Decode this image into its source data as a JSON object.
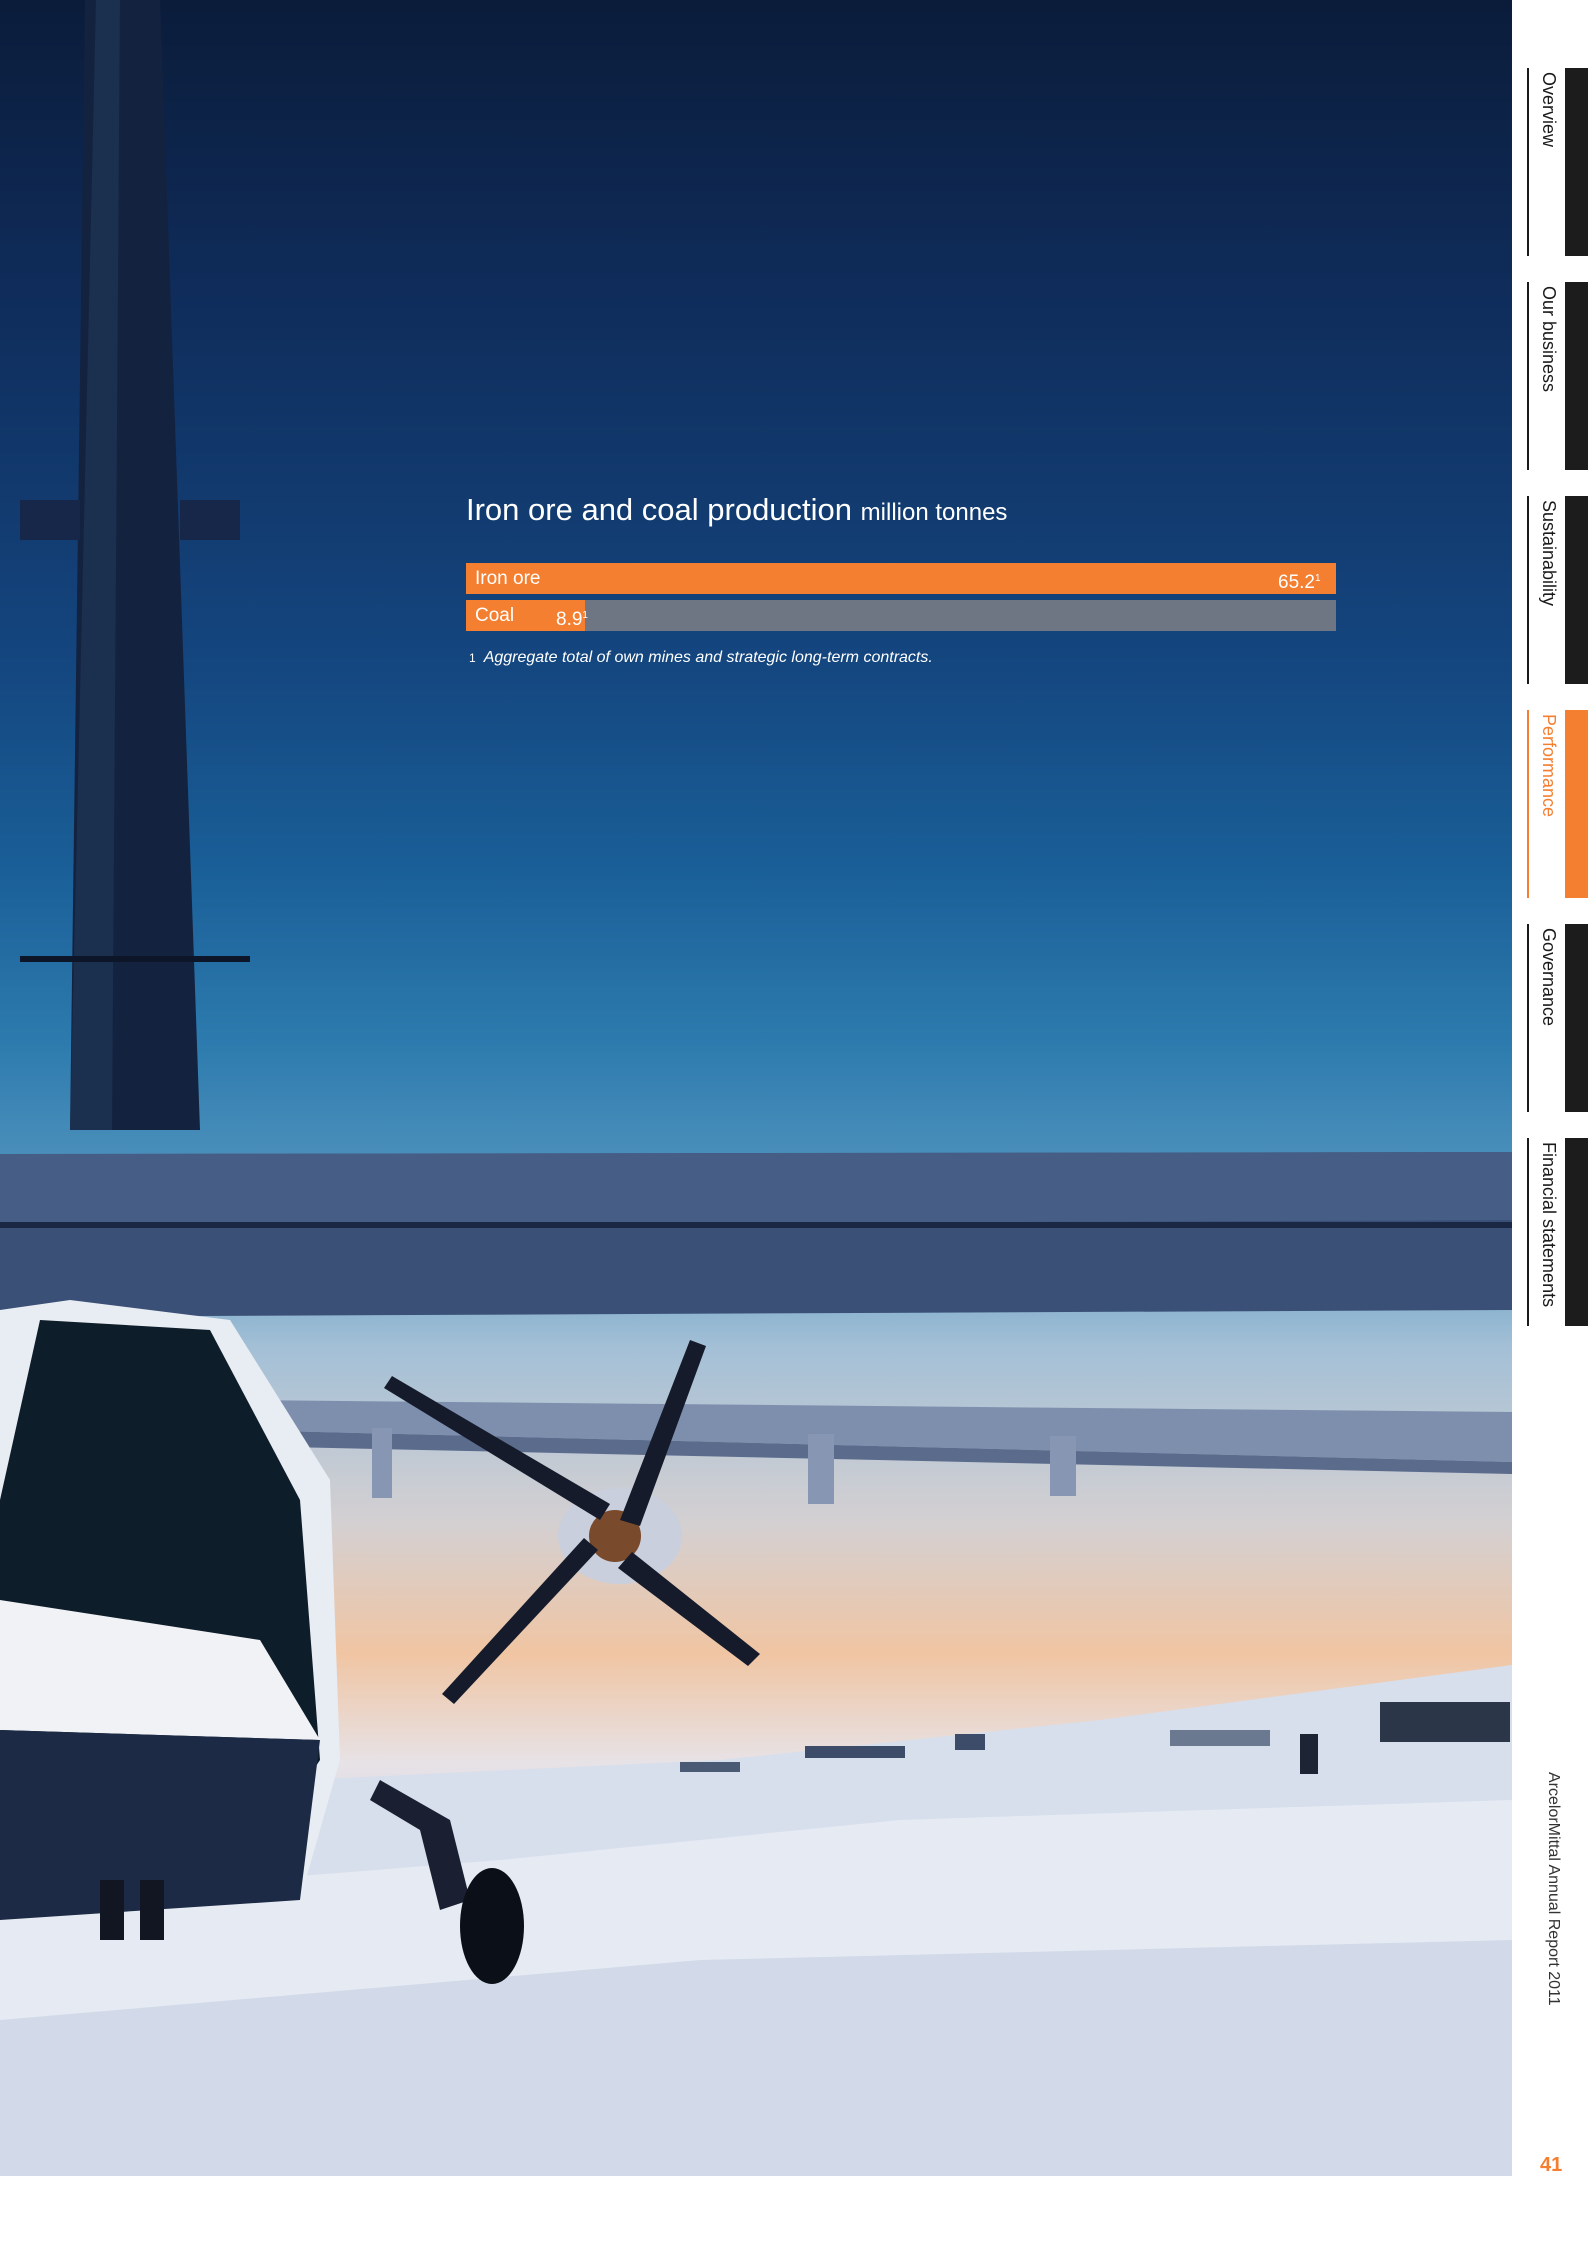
{
  "nav": {
    "items": [
      {
        "label": "Overview"
      },
      {
        "label": "Our business"
      },
      {
        "label": "Sustainability"
      },
      {
        "label": "Performance",
        "active": true
      },
      {
        "label": "Governance"
      },
      {
        "label": "Financial statements"
      }
    ],
    "active_color": "#f47f31"
  },
  "chart": {
    "title": "Iron ore and coal production",
    "unit": "million tonnes",
    "footnote_mark": "1",
    "footnote": "Aggregate total of own mines and strategic long-term contracts."
  },
  "chart_data": {
    "type": "bar",
    "orientation": "horizontal",
    "title": "Iron ore and coal production",
    "unit": "million tonnes",
    "categories": [
      "Iron ore",
      "Coal"
    ],
    "values": [
      65.2,
      8.9
    ],
    "value_labels": [
      "65.2",
      "8.9"
    ],
    "footnote_marks": [
      "1",
      "1"
    ],
    "xlim": [
      0,
      65.2
    ],
    "bar_color": "#f47f31",
    "track_color": "#6f7683"
  },
  "footer": {
    "report_title": "ArcelorMittal Annual Report 2011",
    "page_number": "41"
  }
}
